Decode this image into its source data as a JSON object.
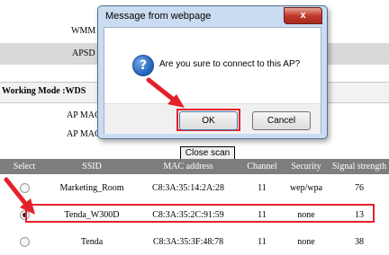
{
  "page": {
    "wmm_label": "WMM",
    "apsd_label": "APSD",
    "working_mode_label": "Working Mode :WDS",
    "ap_mac_label_1": "AP MAC",
    "ap_mac_label_2": "AP MAC",
    "close_scan_label": "Close scan"
  },
  "table": {
    "headers": [
      "Select",
      "SSID",
      "MAC address",
      "Channel",
      "Security",
      "Signal strength"
    ],
    "rows": [
      {
        "selected": false,
        "ssid": "Marketing_Room",
        "mac": "C8:3A:35:14:2A:28",
        "channel": "11",
        "security": "wep/wpa",
        "signal": "76"
      },
      {
        "selected": true,
        "ssid": "Tenda_W300D",
        "mac": "C8:3A:35:2C:91:59",
        "channel": "11",
        "security": "none",
        "signal": "13"
      },
      {
        "selected": false,
        "ssid": "Tenda",
        "mac": "C8:3A:35:3F:48:78",
        "channel": "11",
        "security": "none",
        "signal": "38"
      }
    ]
  },
  "dialog": {
    "title": "Message from webpage",
    "close_glyph": "x",
    "icon": "question-icon",
    "icon_glyph": "?",
    "message": "Are you sure to connect to this AP?",
    "ok_label": "OK",
    "cancel_label": "Cancel"
  },
  "colors": {
    "highlight_red": "#e4202a",
    "header_gray": "#7e7e7e",
    "dialog_frame": "#c9dcf1"
  }
}
